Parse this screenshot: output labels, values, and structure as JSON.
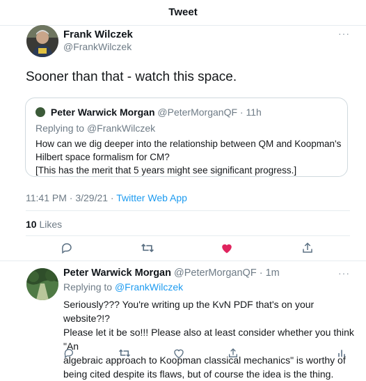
{
  "header": {
    "title": "Tweet"
  },
  "tweet": {
    "author_name": "Frank Wilczek",
    "author_handle": "@FrankWilczek",
    "text": "Sooner than that - watch this space.",
    "timestamp": "11:41 PM · 3/29/21 · ",
    "source": "Twitter Web App",
    "likes_count": "10",
    "likes_label": "Likes",
    "more_icon": "ellipsis-icon"
  },
  "quote": {
    "author_name": "Peter Warwick Morgan",
    "author_handle": "@PeterMorganQF",
    "time": "· 11h",
    "replying_prefix": "Replying to ",
    "replying_handle": "@FrankWilczek",
    "body_line1": "How can we dig deeper into the relationship between QM and Koopman's",
    "body_line2": "Hilbert space formalism for CM?",
    "body_line3": "[This has the merit that 5 years might see significant progress.]"
  },
  "actions": {
    "icons": [
      "reply-icon",
      "retweet-icon",
      "like-icon-filled",
      "share-icon"
    ],
    "colors": {
      "like": "#e0245e",
      "icon": "#5b7083",
      "link": "#1d9bf0"
    }
  },
  "reply": {
    "author_name": "Peter Warwick Morgan",
    "author_handle": "@PeterMorganQF",
    "time": "· 1m",
    "replying_prefix": "Replying to ",
    "replying_handle": "@FrankWilczek",
    "body_line1": "Seriously??? You're writing up the KvN PDF that's on your website?!?",
    "body_line2": "Please let it be so!!! Please also at least consider whether you think \"An",
    "body_line3": "algebraic approach to Koopman classical mechanics\" is worthy of",
    "body_line4": "being cited despite its flaws, but of course the idea is the thing."
  }
}
